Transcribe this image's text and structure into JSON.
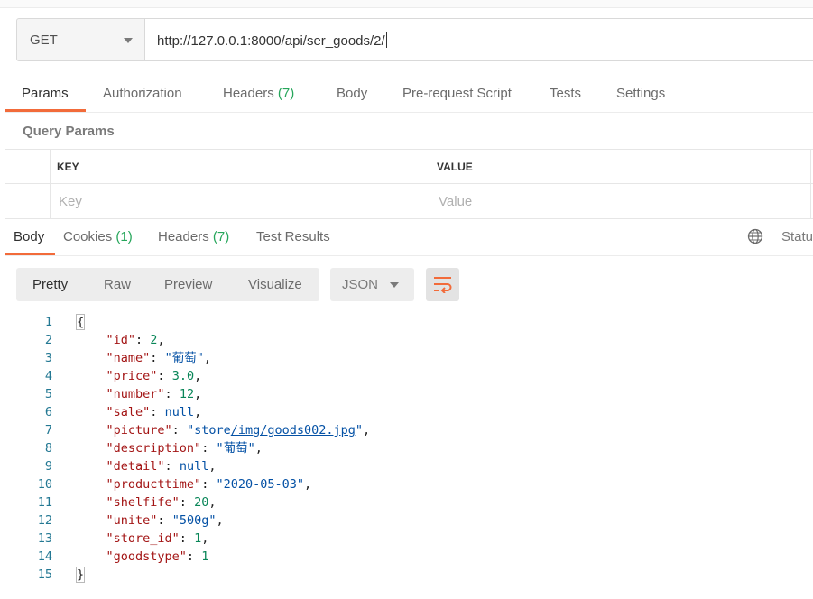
{
  "request": {
    "method": "GET",
    "url": "http://127.0.0.1:8000/api/ser_goods/2/",
    "tabs": [
      {
        "label": "Params",
        "count": ""
      },
      {
        "label": "Authorization",
        "count": ""
      },
      {
        "label": "Headers",
        "count": "(7)"
      },
      {
        "label": "Body",
        "count": ""
      },
      {
        "label": "Pre-request Script",
        "count": ""
      },
      {
        "label": "Tests",
        "count": ""
      },
      {
        "label": "Settings",
        "count": ""
      }
    ],
    "active_tab": "Params",
    "query_params": {
      "title": "Query Params",
      "columns": [
        "KEY",
        "VALUE"
      ],
      "key_placeholder": "Key",
      "value_placeholder": "Value"
    }
  },
  "response": {
    "tabs": [
      {
        "label": "Body",
        "count": ""
      },
      {
        "label": "Cookies",
        "count": "(1)"
      },
      {
        "label": "Headers",
        "count": "(7)"
      },
      {
        "label": "Test Results",
        "count": ""
      }
    ],
    "active_tab": "Body",
    "status_label": "Status",
    "view_modes": [
      "Pretty",
      "Raw",
      "Preview",
      "Visualize"
    ],
    "active_view": "Pretty",
    "format": "JSON",
    "body_lines": [
      "{",
      "    \"id\": 2,",
      "    \"name\": \"葡萄\",",
      "    \"price\": 3.0,",
      "    \"number\": 12,",
      "    \"sale\": null,",
      "    \"picture\": \"store/img/goods002.jpg\",",
      "    \"description\": \"葡萄\",",
      "    \"detail\": null,",
      "    \"producttime\": \"2020-05-03\",",
      "    \"shelfife\": 20,",
      "    \"unite\": \"500g\",",
      "    \"store_id\": 1,",
      "    \"goodstype\": 1",
      "}"
    ]
  },
  "icons": {
    "method_dropdown": "chevron-down-icon",
    "format_dropdown": "chevron-down-icon",
    "wrap": "wrap-lines-icon",
    "globe": "globe-icon"
  },
  "colors": {
    "accent": "#f26b3a",
    "count_green": "#26a65b",
    "json_key": "#a31515",
    "json_string": "#0451a5",
    "json_number": "#098658",
    "line_number": "#237893"
  }
}
